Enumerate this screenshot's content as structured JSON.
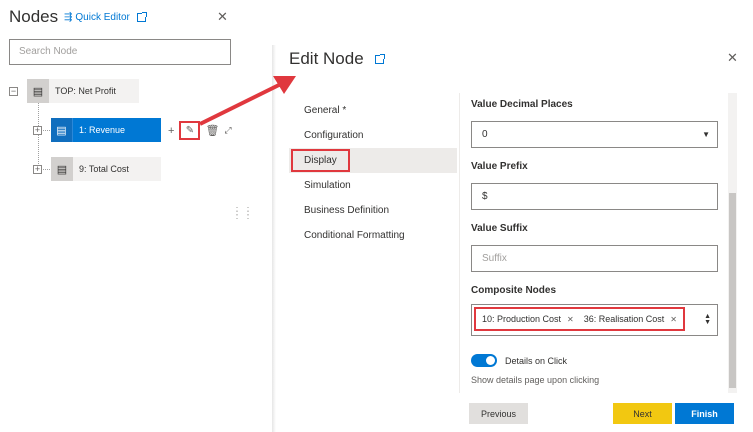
{
  "nodes_panel": {
    "title": "Nodes",
    "quick_editor_label": "Quick Editor",
    "search_placeholder": "Search Node",
    "tree": [
      {
        "label": "TOP: Net Profit",
        "expander": "−"
      },
      {
        "label": "1: Revenue",
        "expander": "+",
        "selected": true
      },
      {
        "label": "9: Total Cost",
        "expander": "+"
      }
    ],
    "actions": {
      "add": "+",
      "edit_icon": "pencil-icon",
      "delete_icon": "trash-icon"
    },
    "close": "✕"
  },
  "edit_panel": {
    "title": "Edit Node",
    "close": "✕",
    "nav": [
      {
        "label": "General *"
      },
      {
        "label": "Configuration"
      },
      {
        "label": "Display",
        "active": true
      },
      {
        "label": "Simulation"
      },
      {
        "label": "Business Definition"
      },
      {
        "label": "Conditional Formatting"
      }
    ],
    "fields": {
      "decimal_places": {
        "label": "Value Decimal Places",
        "value": "0"
      },
      "prefix": {
        "label": "Value Prefix",
        "value": "$"
      },
      "suffix": {
        "label": "Value Suffix",
        "placeholder": "Suffix"
      },
      "composite": {
        "label": "Composite Nodes",
        "chips": [
          "10: Production Cost",
          "36: Realisation Cost"
        ]
      },
      "details_toggle": {
        "label": "Details on Click",
        "on": true,
        "help": "Show details page upon clicking"
      }
    },
    "buttons": {
      "previous": "Previous",
      "next": "Next",
      "finish": "Finish"
    }
  },
  "colors": {
    "accent": "#0078d4",
    "highlight": "#e0383e",
    "next_button": "#f2c811"
  }
}
